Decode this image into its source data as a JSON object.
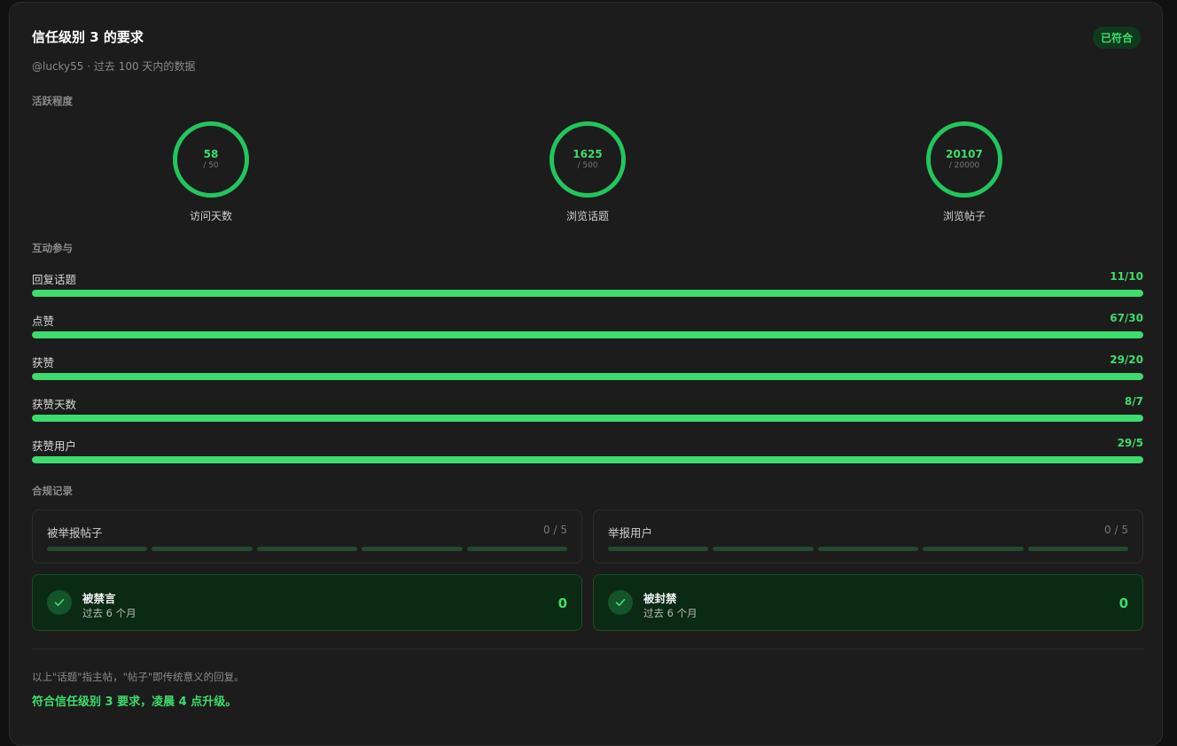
{
  "header": {
    "title": "信任级别 3 的要求",
    "badge": "已符合",
    "subtitle": "@lucky55 · 过去 100 天内的数据"
  },
  "sections": {
    "activity": "活跃程度",
    "interaction": "互动参与",
    "compliance": "合规记录"
  },
  "activity": [
    {
      "value": "58",
      "target": "/ 50",
      "label": "访问天数"
    },
    {
      "value": "1625",
      "target": "/ 500",
      "label": "浏览话题"
    },
    {
      "value": "20107",
      "target": "/ 20000",
      "label": "浏览帖子"
    }
  ],
  "interaction": [
    {
      "label": "回复话题",
      "value": "11/10",
      "progress": 1.0
    },
    {
      "label": "点赞",
      "value": "67/30",
      "progress": 1.0
    },
    {
      "label": "获赞",
      "value": "29/20",
      "progress": 1.0
    },
    {
      "label": "获赞天数",
      "value": "8/7",
      "progress": 1.0
    },
    {
      "label": "获赞用户",
      "value": "29/5",
      "progress": 1.0
    }
  ],
  "reports": [
    {
      "label": "被举报帖子",
      "count": "0 / 5",
      "filled": 0,
      "segments": 5
    },
    {
      "label": "举报用户",
      "count": "0 / 5",
      "filled": 0,
      "segments": 5
    }
  ],
  "bans": [
    {
      "title": "被禁言",
      "subtitle": "过去 6 个月",
      "count": "0"
    },
    {
      "title": "被封禁",
      "subtitle": "过去 6 个月",
      "count": "0"
    }
  ],
  "footer": {
    "note": "以上\"话题\"指主帖，\"帖子\"即传统意义的回复。",
    "summary": "符合信任级别 3 要求，凌晨 4 点升级。"
  },
  "colors": {
    "accent": "#22c55e",
    "accent_text": "#3ddc6c",
    "background": "#1c1c1c"
  },
  "icons": {
    "ban_check": "check-icon"
  }
}
